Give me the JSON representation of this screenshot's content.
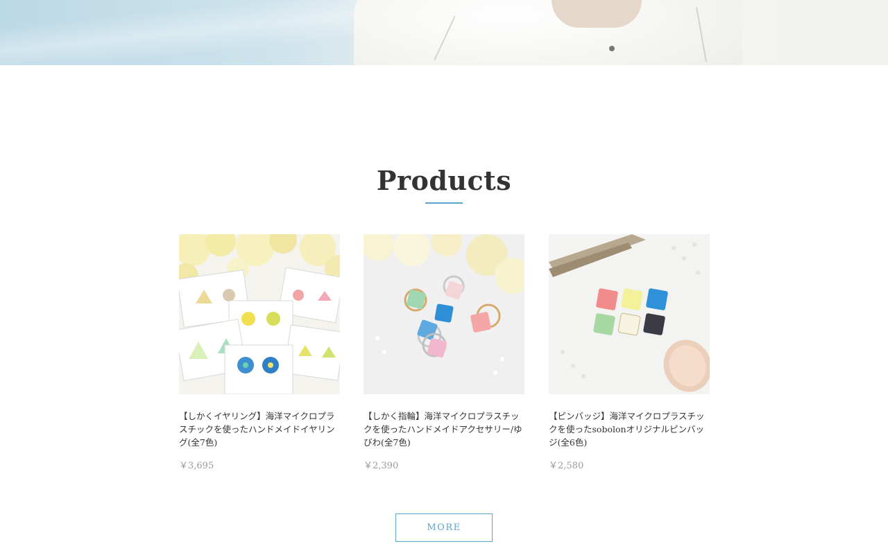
{
  "section": {
    "title": "Products"
  },
  "products": [
    {
      "name": "【しかくイヤリング】海洋マイクロプラスチックを使ったハンドメイドイヤリング(全7色)",
      "price": "￥3,695",
      "image": "earrings-photo"
    },
    {
      "name": "【しかく指輪】海洋マイクロプラスチックを使ったハンドメイドアクセサリー/ゆびわ(全7色)",
      "price": "￥2,390",
      "image": "rings-photo"
    },
    {
      "name": "【ピンバッジ】海洋マイクロプラスチックを使ったsobolonオリジナルピンバッジ(全6色)",
      "price": "￥2,580",
      "image": "pin-badges-photo"
    }
  ],
  "more_button": {
    "label": "MORE"
  },
  "colors": {
    "accent": "#5aa5cf",
    "text": "#333333",
    "price": "#9a9a9a"
  }
}
